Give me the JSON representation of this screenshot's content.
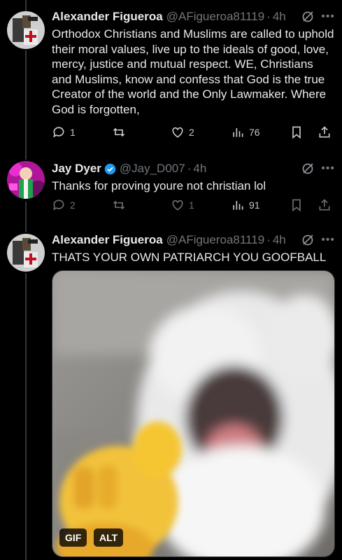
{
  "tweets": [
    {
      "name": "Alexander Figueroa",
      "handle": "@AFigueroa81119",
      "time": "4h",
      "text": "Orthodox Christians and Muslims are called to uphold their moral values, live up to the ideals of good, love, mercy, justice and mutual respect. WE, Christians and Muslims, know and confess that God is the true Creator of the world and the Only Lawmaker. Where God is forgotten,",
      "replies": "1",
      "retweets": "",
      "likes": "2",
      "views": "76"
    },
    {
      "name": "Jay Dyer",
      "handle": "@Jay_D007",
      "time": "4h",
      "text": "Thanks for proving youre not christian lol",
      "replies": "2",
      "retweets": "",
      "likes": "1",
      "views": "91"
    },
    {
      "name": "Alexander Figueroa",
      "handle": "@AFigueroa81119",
      "time": "4h",
      "text": "THATS YOUR OWN PATRIARCH YOU GOOFBALL",
      "gif_label": "GIF",
      "alt_label": "ALT"
    }
  ],
  "separator": "·",
  "colors": {
    "background": "#000000",
    "text": "#e7e9ea",
    "muted": "#71767b",
    "verified": "#1d9bf0",
    "line": "#333639"
  }
}
